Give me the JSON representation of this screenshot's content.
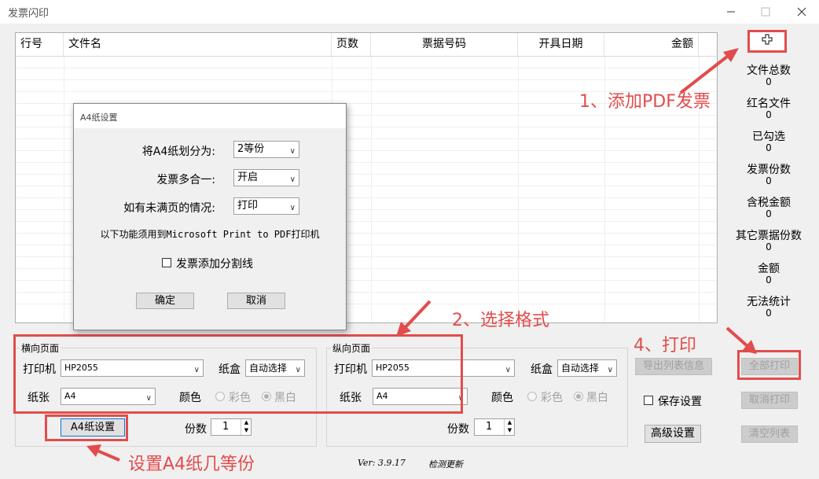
{
  "window": {
    "title": "发票闪印",
    "minimize_icon": "minimize-icon",
    "maximize_icon": "maximize-icon",
    "close_icon": "close-icon"
  },
  "table": {
    "columns": [
      "行号",
      "文件名",
      "页数",
      "票据号码",
      "开具日期",
      "金额"
    ]
  },
  "stats": [
    {
      "label": "文件总数",
      "value": "0"
    },
    {
      "label": "红名文件",
      "value": "0"
    },
    {
      "label": "已勾选",
      "value": "0"
    },
    {
      "label": "发票份数",
      "value": "0"
    },
    {
      "label": "含税金额",
      "value": "0"
    },
    {
      "label": "其它票据份数",
      "value": "0"
    },
    {
      "label": "金额",
      "value": "0"
    },
    {
      "label": "无法统计",
      "value": "0"
    }
  ],
  "add_button_icon": "plus-icon",
  "dialog": {
    "title": "A4纸设置",
    "split_label": "将A4纸划分为:",
    "split_value": "2等份",
    "merge_label": "发票多合一:",
    "merge_value": "开启",
    "partial_label": "如有未满页的情况:",
    "partial_value": "打印",
    "note": "以下功能须用到Microsoft Print to PDF打印机",
    "divider_checkbox": "发票添加分割线",
    "ok": "确定",
    "cancel": "取消"
  },
  "landscape": {
    "title": "横向页面",
    "printer_label": "打印机",
    "printer_value": "HP2055",
    "tray_label": "纸盒",
    "tray_value": "自动选择",
    "paper_label": "纸张",
    "paper_value": "A4",
    "color_label": "颜色",
    "color_option": "彩色",
    "bw_option": "黑白"
  },
  "portrait": {
    "title": "纵向页面",
    "printer_label": "打印机",
    "printer_value": "HP2055",
    "tray_label": "纸盒",
    "tray_value": "自动选择",
    "paper_label": "纸张",
    "paper_value": "A4",
    "color_label": "颜色",
    "color_option": "彩色",
    "bw_option": "黑白"
  },
  "a4_settings_button": "A4纸设置",
  "copies_label": "份数",
  "copies_value": "1",
  "copies_label_2": "份数",
  "copies_value_2": "1",
  "buttons": {
    "export": "导出列表信息",
    "save_settings": "保存设置",
    "advanced": "高级设置",
    "print_all": "全部打印",
    "cancel_print": "取消打印",
    "clear_list": "清空列表"
  },
  "version": "Ver: 3.9.17",
  "check_update": "检测更新",
  "annotations": {
    "a1": "1、添加PDF发票",
    "a2": "2、选择格式",
    "a3": "设置A4纸几等份",
    "a4": "4、打印"
  },
  "colors": {
    "annotation_red": "#e24c4c"
  }
}
